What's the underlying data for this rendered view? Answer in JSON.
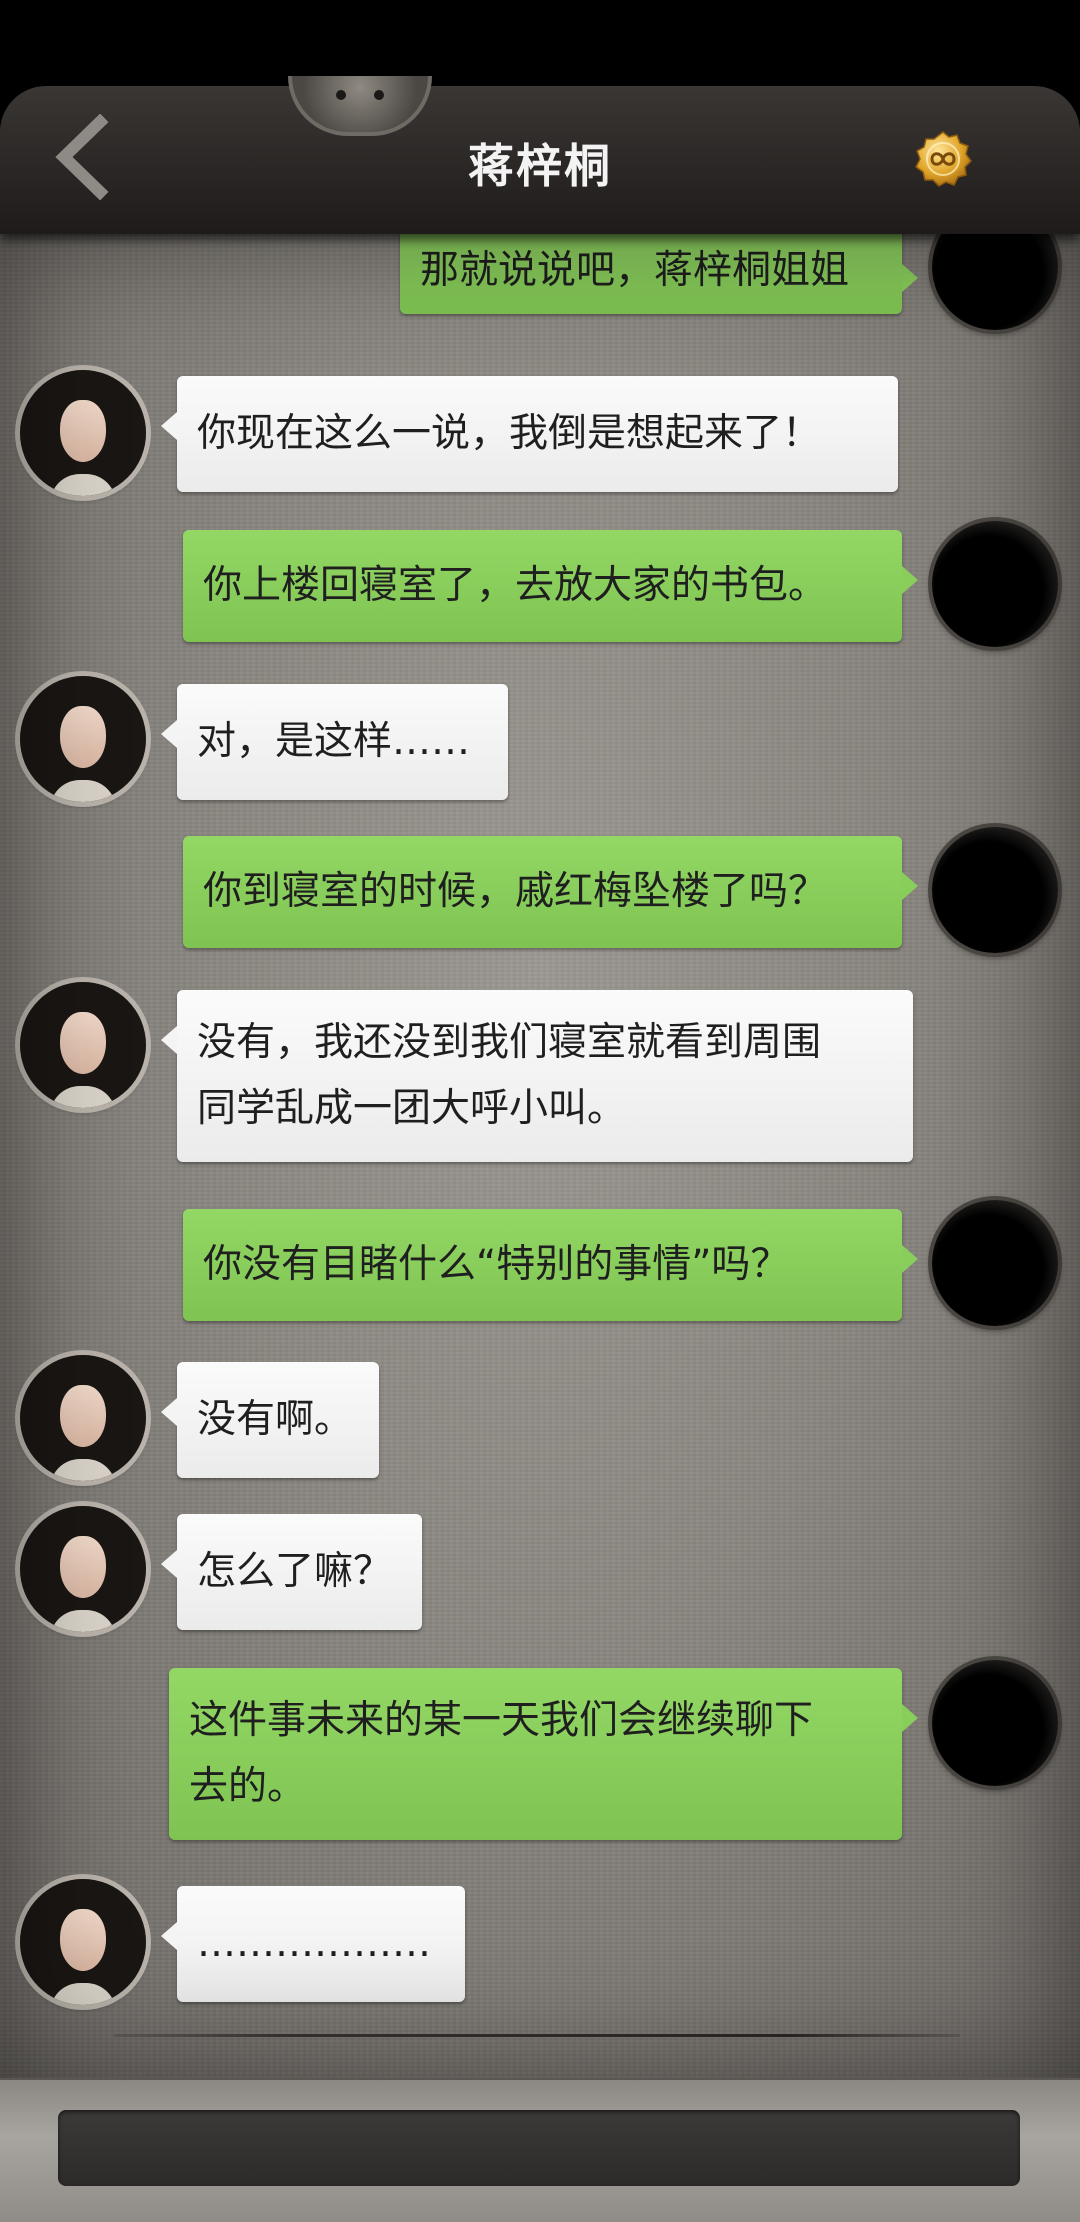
{
  "header": {
    "title": "蒋梓桐"
  },
  "messages": [
    {
      "side": "right",
      "text": "那就说说吧，蒋梓桐姐姐"
    },
    {
      "side": "left",
      "text": "你现在这么一说，我倒是想起来了！"
    },
    {
      "side": "right",
      "text": "你上楼回寝室了，去放大家的书包。"
    },
    {
      "side": "left",
      "text": "对，是这样……"
    },
    {
      "side": "right",
      "text": "你到寝室的时候，戚红梅坠楼了吗？"
    },
    {
      "side": "left",
      "lines": [
        "没有，我还没到我们寝室就看到周围",
        "同学乱成一团大呼小叫。"
      ]
    },
    {
      "side": "right",
      "text": "你没有目睹什么“特别的事情”吗？"
    },
    {
      "side": "left",
      "text": "没有啊。"
    },
    {
      "side": "left",
      "text": "怎么了嘛？"
    },
    {
      "side": "right",
      "lines": [
        "这件事未来的某一天我们会继续聊下",
        "去的。"
      ]
    },
    {
      "side": "left",
      "text": "………………"
    }
  ],
  "input": {
    "value": ""
  },
  "icons": {
    "back": "back-chevron-icon",
    "badge": "infinity-coin-icon"
  }
}
